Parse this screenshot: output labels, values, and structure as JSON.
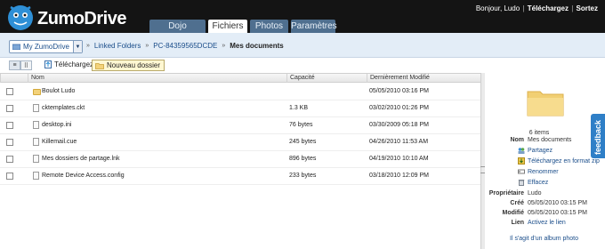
{
  "header": {
    "brand": "ZumoDrive",
    "greeting": "Bonjour, Ludo",
    "download_link": "Téléchargez",
    "logout_link": "Sortez",
    "tabs": [
      {
        "label": "Dojo",
        "active": false
      },
      {
        "label": "Fichiers",
        "active": true
      },
      {
        "label": "Photos",
        "active": false
      },
      {
        "label": "Paramètres",
        "active": false
      }
    ]
  },
  "breadcrumb": {
    "root": "My ZumoDrive",
    "items": [
      "Linked Folders",
      "PC-84359565DCDE"
    ],
    "current": "Mes documents"
  },
  "toolbar": {
    "upload_label": "Téléchargez",
    "new_folder_label": "Nouveau dossier"
  },
  "table": {
    "columns": [
      "Nom",
      "Capacité",
      "Dernièrement Modifié"
    ],
    "rows": [
      {
        "icon": "folder-icon",
        "name": "Boulot Ludo",
        "size": "",
        "modified": "05/05/2010 03:16 PM"
      },
      {
        "icon": "file-icon",
        "name": "cktemplates.ckt",
        "size": "1.3 KB",
        "modified": "03/02/2010 01:26 PM"
      },
      {
        "icon": "file-icon",
        "name": "desktop.ini",
        "size": "76 bytes",
        "modified": "03/30/2009 05:18 PM"
      },
      {
        "icon": "file-icon",
        "name": "Killemail.cue",
        "size": "245 bytes",
        "modified": "04/26/2010 11:53 AM"
      },
      {
        "icon": "file-icon",
        "name": "Mes dossiers de partage.lnk",
        "size": "896 bytes",
        "modified": "04/19/2010 10:10 AM"
      },
      {
        "icon": "file-icon",
        "name": "Remote Device Access.config",
        "size": "233 bytes",
        "modified": "03/18/2010 12:09 PM"
      }
    ]
  },
  "panel": {
    "items_count": "6 items",
    "name_label": "Nom",
    "name_value": "Mes documents",
    "actions": {
      "share": "Partagez",
      "download_zip": "Téléchargez en format zip",
      "rename": "Renommer",
      "delete": "Effacez"
    },
    "owner_label": "Propriétaire",
    "owner_value": "Ludo",
    "created_label": "Créé",
    "created_value": "05/05/2010 03:15 PM",
    "modified_label": "Modifié",
    "modified_value": "05/05/2010 03:15 PM",
    "link_label": "Lien",
    "link_value": "Activez le lien",
    "album_link": "Il s'agit d'un album photo"
  },
  "feedback_label": "feedback",
  "colors": {
    "header_bg": "#141414",
    "tab_bg": "#4f6f8f",
    "link": "#1a4d8a",
    "crumb_bar": "#e3edf7",
    "feedback": "#2f7fc7"
  }
}
